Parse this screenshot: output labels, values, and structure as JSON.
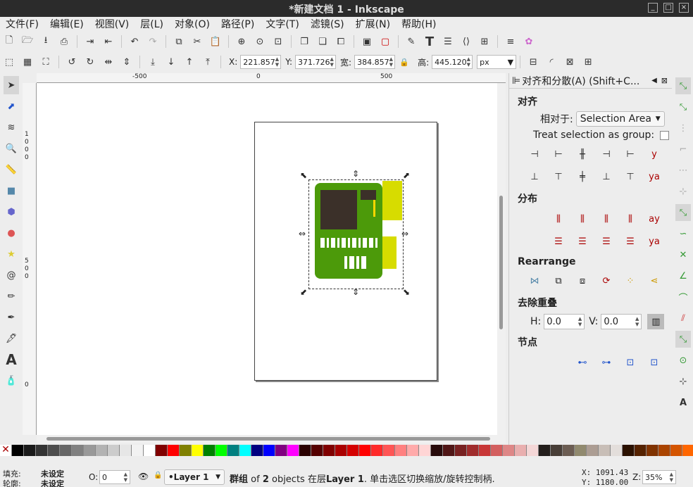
{
  "window": {
    "title": "*新建文档 1 - Inkscape",
    "btn_min": "_",
    "btn_max": "□",
    "btn_close": "×"
  },
  "menu": [
    "文件(F)",
    "编辑(E)",
    "视图(V)",
    "层(L)",
    "对象(O)",
    "路径(P)",
    "文字(T)",
    "滤镜(S)",
    "扩展(N)",
    "帮助(H)"
  ],
  "toolbar": {
    "x_label": "X:",
    "x_value": "221.857",
    "y_label": "Y:",
    "y_value": "371.726",
    "w_label": "宽:",
    "w_value": "384.857",
    "h_label": "高:",
    "h_value": "445.120",
    "unit": "px"
  },
  "ruler": {
    "top_ticks": [
      "-500",
      "0",
      "500"
    ],
    "left_ticks": [
      "1",
      "0",
      "0",
      "0",
      "5",
      "0",
      "0",
      "0"
    ]
  },
  "panel": {
    "title": "对齐和分散(A) (Shift+C...",
    "align_section": "对齐",
    "relative_label": "相对于:",
    "relative_value": "Selection Area",
    "treat_group": "Treat selection as group:",
    "distribute_section": "分布",
    "rearrange_section": "Rearrange",
    "overlap_section": "去除重叠",
    "h_label": "H:",
    "h_value": "0.0",
    "v_label": "V:",
    "v_value": "0.0",
    "nodes_section": "节点"
  },
  "palette": [
    "#000000",
    "#1a1a1a",
    "#333333",
    "#4d4d4d",
    "#666666",
    "#808080",
    "#999999",
    "#b3b3b3",
    "#cccccc",
    "#e6e6e6",
    "#f2f2f2",
    "#ffffff",
    "#800000",
    "#ff0000",
    "#808000",
    "#ffff00",
    "#008000",
    "#00ff00",
    "#008080",
    "#00ffff",
    "#000080",
    "#0000ff",
    "#800080",
    "#ff00ff",
    "#2b0000",
    "#550000",
    "#800000",
    "#aa0000",
    "#d40000",
    "#ff0000",
    "#ff2a2a",
    "#ff5555",
    "#ff8080",
    "#ffaaaa",
    "#ffd5d5",
    "#280b0b",
    "#501616",
    "#782121",
    "#a02c2c",
    "#c83737",
    "#d35f5f",
    "#de8787",
    "#e9afaf",
    "#f4d7d7",
    "#241f1c",
    "#483e37",
    "#6c5d53",
    "#918a6f",
    "#ac9d93",
    "#c8beb7",
    "#e3dedb",
    "#2b1100",
    "#552200",
    "#803300",
    "#aa4400",
    "#d45500",
    "#ff6600",
    "#ff7f2a",
    "#ff9955"
  ],
  "status": {
    "fill_label": "填充:",
    "fill_value": "未设定",
    "stroke_label": "轮廓:",
    "stroke_value": "未设定",
    "opacity_label": "O:",
    "opacity_value": "0",
    "layer": "•Layer 1",
    "msg_a": "群组",
    "msg_b": " of ",
    "msg_c": "2",
    "msg_d": " objects 在层",
    "msg_e": "Layer 1",
    "msg_f": ". 单击选区切换缩放/旋转控制柄.",
    "x": "X: 1091.43",
    "y": "Y: 1180.00",
    "zoom_label": "Z:",
    "zoom_value": "35%"
  },
  "colors": {
    "board": "#4c9a0a",
    "chip": "#3b3029",
    "yellow": "#d7dc00",
    "accent": "#ffd700"
  }
}
